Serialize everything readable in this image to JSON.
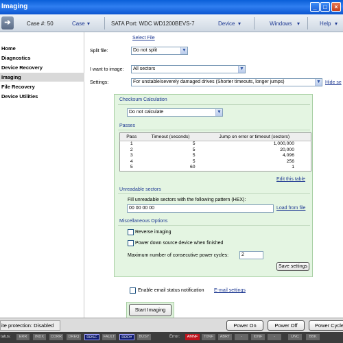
{
  "window": {
    "title": "Imaging"
  },
  "toolbar": {
    "case_label": "Case #: 50",
    "case_menu": "Case",
    "sata_port": "SATA Port: WDC WD1200BEVS-7",
    "device_menu": "Device",
    "windows_menu": "Windows",
    "help_menu": "Help"
  },
  "sidebar": {
    "items": [
      {
        "label": "Home",
        "active": false
      },
      {
        "label": "Diagnostics",
        "active": false
      },
      {
        "label": "Device Recovery",
        "active": false
      },
      {
        "label": "Imaging",
        "active": true
      },
      {
        "label": "File Recovery",
        "active": false
      },
      {
        "label": "Device Utilities",
        "active": false
      }
    ]
  },
  "form": {
    "select_file": "Select File",
    "split_label": "Split file:",
    "split_value": "Do not split",
    "image_label": "I want to image:",
    "image_value": "All sectors",
    "settings_label": "Settings:",
    "settings_value": "For unstable/severely damaged drives (Shorter timeouts, longer jumps)",
    "hide_settings": "Hide se"
  },
  "panel": {
    "checksum_title": "Checksum Calculation",
    "checksum_value": "Do not calculate",
    "passes_title": "Passes",
    "table_headers": [
      "Pass",
      "Timeout (seconds)",
      "Jump on error or timeout (sectors)"
    ],
    "table_rows": [
      [
        "1",
        "5",
        "1,000,000"
      ],
      [
        "2",
        "5",
        "20,000"
      ],
      [
        "3",
        "5",
        "4,096"
      ],
      [
        "4",
        "5",
        "256"
      ],
      [
        "5",
        "60",
        "1"
      ]
    ],
    "edit_table": "Edit this table",
    "unreadable_title": "Unreadable sectors",
    "fill_label": "Fill unreadable sectors with the following pattern (HEX):",
    "fill_value": "00 00 00 00",
    "load_file": "Load from file",
    "misc_title": "Miscellaneous Options",
    "reverse_label": "Reverse imaging",
    "powerdown_label": "Power down source device when finished",
    "max_cycles_label": "Maximum number of consecutive power cycles:",
    "max_cycles_value": "2",
    "save_settings": "Save settings"
  },
  "email": {
    "label": "Enable email status notification",
    "settings_link": "E-mail settings"
  },
  "start_button": "Start Imaging",
  "statusbar": {
    "write_protection": "ite protection: Disabled",
    "power_on": "Power On",
    "power_off": "Power Off",
    "power_cycle": "Power Cycle",
    "status_label": "tatus:",
    "error_label": "Error:",
    "status_flags": [
      {
        "label": "ERR",
        "on": false
      },
      {
        "label": "INDX",
        "on": false
      },
      {
        "label": "CORR",
        "on": false
      },
      {
        "label": "DREQ",
        "on": false
      },
      {
        "label": "DRSC",
        "on": true
      },
      {
        "label": "FAULT",
        "on": false
      },
      {
        "label": "DRDY",
        "on": true
      },
      {
        "label": "BUSY",
        "on": false
      }
    ],
    "error_flags": [
      {
        "label": "AMNF",
        "on": true
      },
      {
        "label": "T0NF",
        "on": false
      },
      {
        "label": "ABRT",
        "on": false
      },
      {
        "label": "-",
        "on": false
      },
      {
        "label": "IDNF",
        "on": false
      },
      {
        "label": "-",
        "on": false
      },
      {
        "label": "UNC",
        "on": false
      },
      {
        "label": "BBK",
        "on": false
      }
    ]
  },
  "colors": {
    "title_bar": "#0a5fd8",
    "panel_bg": "#e4f5e2",
    "link": "#1f3a93",
    "flag_on": "#0d1a6e",
    "flag_error": "#c0141d"
  }
}
